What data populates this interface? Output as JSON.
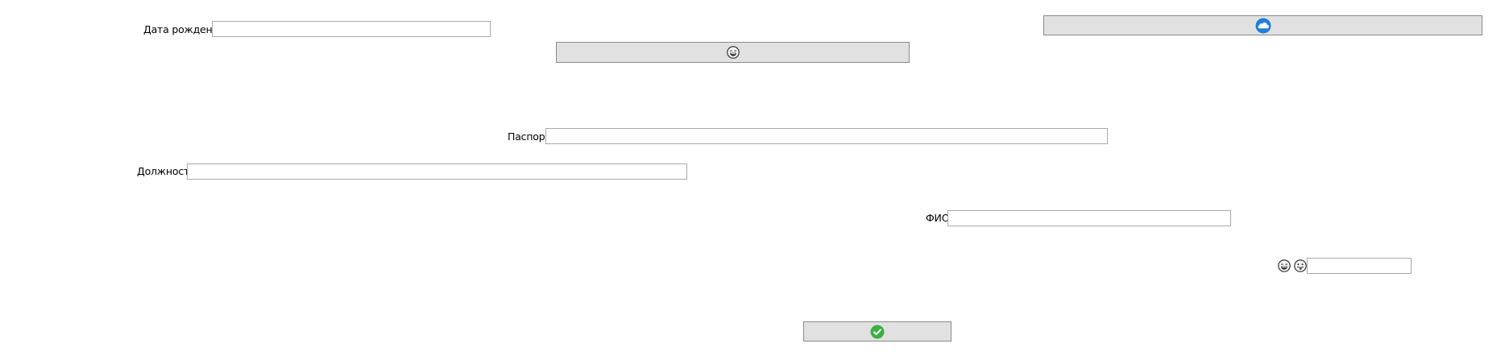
{
  "form": {
    "birth_date": {
      "label": "Дата рождения",
      "value": ""
    },
    "passport": {
      "label": "Паспорт",
      "value": ""
    },
    "position": {
      "label": "Должность",
      "value": ""
    },
    "full_name": {
      "label": "ФИО",
      "value": ""
    },
    "emoji_input": {
      "value": ""
    }
  },
  "icons": {
    "top_right_button": "blue-cloud-icon",
    "top_middle_button": "laughing-face-icon",
    "emoji_left": "laughing-face-icon",
    "emoji_right": "tongue-face-icon",
    "confirm_button": "green-checkmark-icon"
  },
  "colors": {
    "button_bg": "#e1e1e1",
    "button_border": "#8a8a8a",
    "field_border": "#a9a9a9",
    "cloud_blue": "#1e7fd8",
    "check_green": "#3cb043"
  }
}
